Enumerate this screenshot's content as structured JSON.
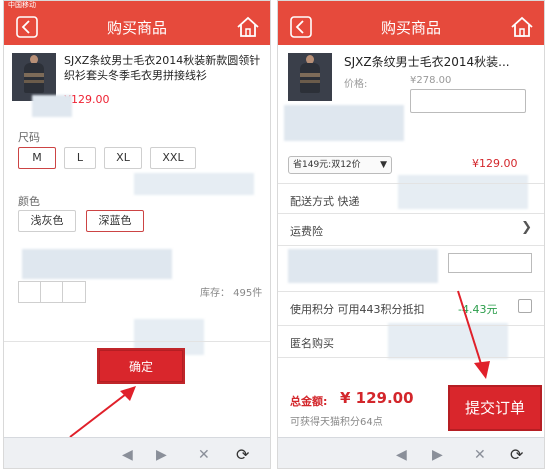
{
  "left_screen": {
    "status": "中国移动",
    "nav_title": "购买商品",
    "product_title": "SJXZ条纹男士毛衣2014秋装新款圆领针织衫套头冬季毛衣男拼接线衫",
    "product_price": "¥129.00",
    "size_label": "尺码",
    "sizes": [
      "M",
      "L",
      "XL",
      "XXL"
    ],
    "color_label": "颜色",
    "colors": [
      "浅灰色",
      "深蓝色"
    ],
    "stock": "库存： 495件",
    "confirm_label": "确定"
  },
  "right_screen": {
    "nav_title": "购买商品",
    "product_title": "SJXZ条纹男士毛衣2014秋装...",
    "price_label": "价格:",
    "price": "¥278.00",
    "promo_select": "省149元:双12价",
    "subtotal": "¥129.00",
    "shipping_label": "配送方式  快递",
    "insurance_label": "运费险",
    "points_label": "使用积分  可用443积分抵扣",
    "points_value": "-4.43元",
    "anonymous_label": "匿名购买",
    "total_label": "总金额:",
    "total_value": "¥ 129.00",
    "earn_points": "可获得天猫积分64点",
    "submit_label": "提交订单"
  },
  "toolbar": {
    "back_icon": "◀",
    "forward_icon": "▶",
    "close_icon": "✕",
    "refresh_icon": "⟳"
  },
  "colors": {
    "brand_red": "#e64a3c",
    "button_red": "#d9262c",
    "accent_green": "#2a9d4a"
  }
}
